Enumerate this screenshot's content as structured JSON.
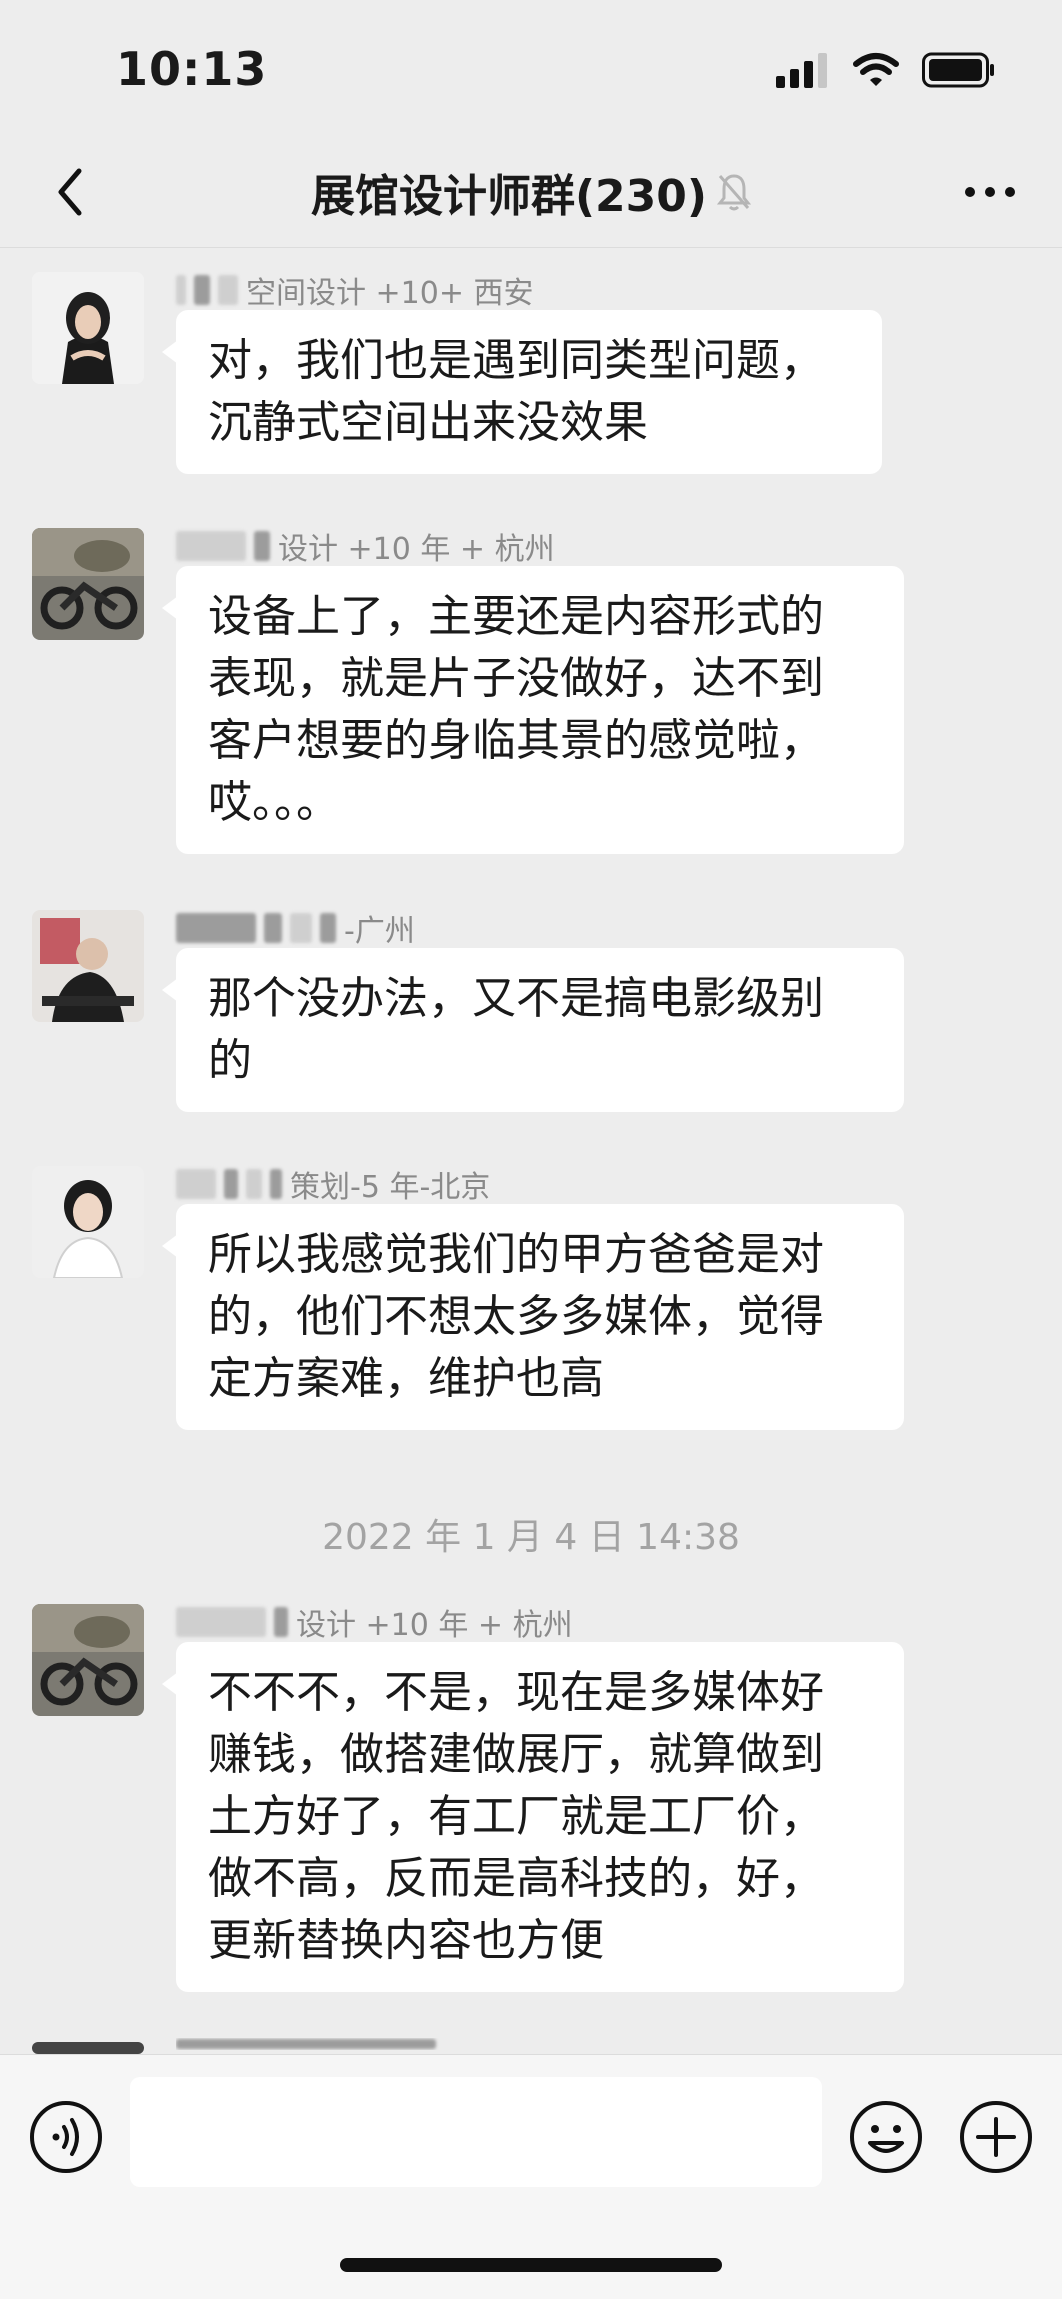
{
  "status_bar": {
    "time": "10:13",
    "icons": [
      "cellular-signal-icon",
      "wifi-icon",
      "battery-icon"
    ]
  },
  "nav": {
    "back_icon": "chevron-left-icon",
    "title": "展馆设计师群(230)",
    "mute_icon": "bell-muted-icon",
    "more_icon": "ellipsis-icon"
  },
  "messages": [
    {
      "sender_visible": "空间设计 +10+ 西安",
      "lines": [
        "对，我们也是遇到同类型问题，",
        "沉静式空间出来没效果"
      ]
    },
    {
      "sender_visible": "设计 +10 年 + 杭州",
      "lines": [
        "设备上了，主要还是内容形式的",
        "表现，就是片子没做好，达不到",
        "客户想要的身临其景的感觉啦，",
        "哎。。。"
      ]
    },
    {
      "sender_visible": "-广州",
      "lines": [
        "那个没办法，又不是搞电影级别",
        "的"
      ]
    },
    {
      "sender_visible": "策划-5 年-北京",
      "lines": [
        "所以我感觉我们的甲方爸爸是对",
        "的，他们不想太多多媒体，觉得",
        "定方案难，维护也高"
      ]
    },
    {
      "sender_visible": "设计 +10 年 + 杭州",
      "lines": [
        "不不不，不是，现在是多媒体好",
        "赚钱，做搭建做展厅，就算做到",
        "土方好了，有工厂就是工厂价，",
        "做不高，反而是高科技的，好，",
        "更新替换内容也方便"
      ]
    }
  ],
  "timestamp": "2022 年 1 月 4 日 14:38",
  "input_bar": {
    "voice_icon": "voice-input-icon",
    "input_value": "",
    "emoji_icon": "emoji-icon",
    "plus_icon": "plus-circle-icon"
  },
  "colors": {
    "background": "#ededed",
    "bubble": "#ffffff",
    "muted_text": "#8a8a8a",
    "input_bar": "#f6f6f6"
  }
}
